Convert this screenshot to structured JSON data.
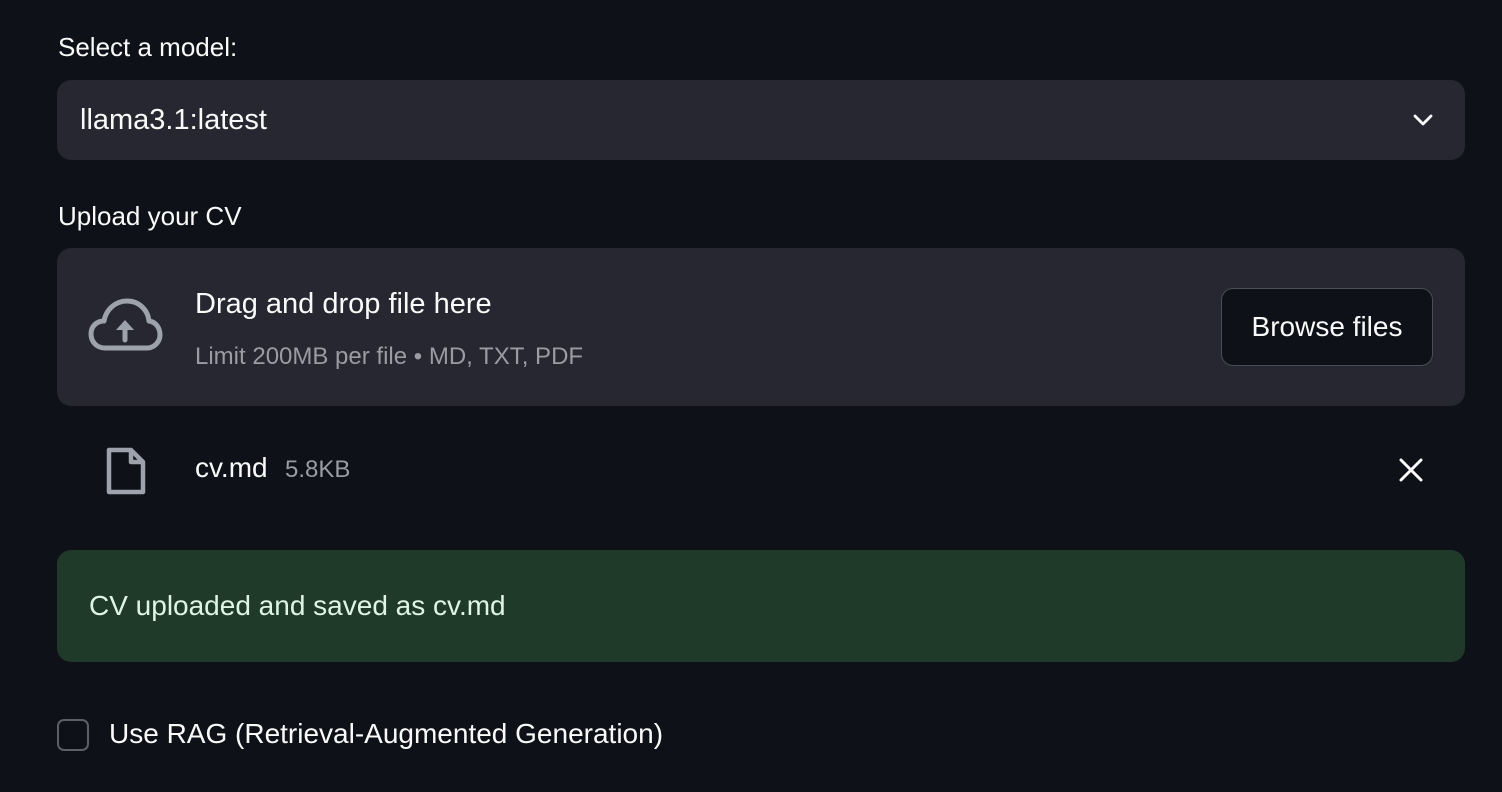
{
  "model_select": {
    "label": "Select a model:",
    "value": "llama3.1:latest",
    "icon": "chevron-down-icon"
  },
  "uploader": {
    "label": "Upload your CV",
    "dropzone_title": "Drag and drop file here",
    "dropzone_limit": "Limit 200MB per file • MD, TXT, PDF",
    "browse_label": "Browse files",
    "icon": "cloud-upload-icon"
  },
  "uploaded_file": {
    "name": "cv.md",
    "size": "5.8KB",
    "icon": "file-icon",
    "remove_icon": "close-icon"
  },
  "success_message": {
    "text": "CV uploaded and saved as cv.md",
    "color": "#203a2a"
  },
  "rag_option": {
    "label": "Use RAG (Retrieval-Augmented Generation)",
    "checked": false
  },
  "theme": {
    "background": "#0e1117",
    "surface": "#262730",
    "text": "#fafafa",
    "muted_text": "#9a9ba3"
  }
}
